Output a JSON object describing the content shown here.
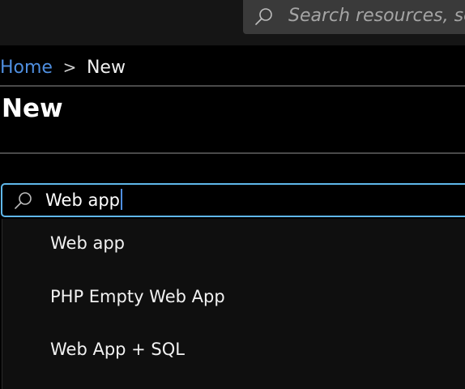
{
  "topbar": {
    "search": {
      "placeholder": "Search resources, ser",
      "icon": "search-icon"
    }
  },
  "breadcrumb": {
    "home": "Home",
    "separator": ">",
    "current": "New"
  },
  "page": {
    "title": "New"
  },
  "search": {
    "icon": "search-icon",
    "value": "Web app"
  },
  "dropdown": {
    "items": [
      {
        "label": "Web app"
      },
      {
        "label": "PHP Empty Web App"
      },
      {
        "label": "Web App + SQL"
      }
    ]
  },
  "colors": {
    "accent_link": "#4f8fe0",
    "focus_border": "#5fb7ea",
    "topbar_bg": "#151515",
    "search_bg": "#3a3a3a"
  }
}
